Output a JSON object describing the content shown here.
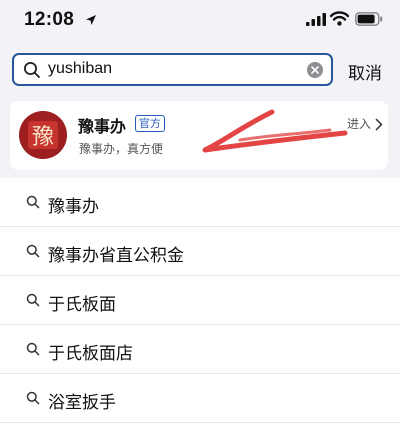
{
  "status_bar": {
    "time": "12:08"
  },
  "search": {
    "query": "yushiban",
    "cancel_label": "取消"
  },
  "official_card": {
    "name": "豫事办",
    "badge": "官方",
    "slogan": "豫事办，真方便",
    "enter_label": "进入",
    "logo_text": "豫",
    "logo_color": "#9e1f1f"
  },
  "suggestions": [
    {
      "label": "豫事办"
    },
    {
      "label": "豫事办省直公积金"
    },
    {
      "label": "于氏板面"
    },
    {
      "label": "于氏板面店"
    },
    {
      "label": "浴室扳手"
    }
  ],
  "colors": {
    "accent_border": "#27589c",
    "annotation_red": "#e03030"
  },
  "icons": [
    "search-icon",
    "clear-icon",
    "chevron-right-icon",
    "location-arrow-icon",
    "signal-icon",
    "wifi-icon",
    "battery-icon"
  ]
}
